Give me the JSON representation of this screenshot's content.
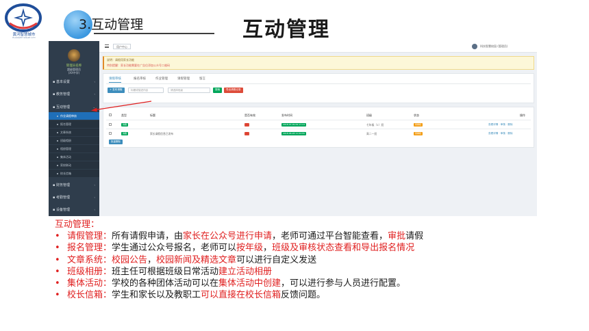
{
  "logo": {
    "name": "黄河智慧城市",
    "subtitle": "HUANGHE SMART CITY"
  },
  "section": {
    "label": "3.互动管理"
  },
  "page_title": "互动管理",
  "screenshot": {
    "sidebar": {
      "user": "管理员名称",
      "role": "超级管理员",
      "school": "(XX中学)",
      "items": [
        {
          "label": "基本设置"
        },
        {
          "label": "教务管理"
        },
        {
          "label": "互动管理"
        },
        {
          "label": "财务管理"
        },
        {
          "label": "考勤管理"
        },
        {
          "label": "设备管理"
        }
      ],
      "subitems": [
        {
          "label": "作业请假审核",
          "active": true
        },
        {
          "label": "报名管理",
          "active": false
        },
        {
          "label": "文章系统",
          "active": false
        },
        {
          "label": "班级相册",
          "active": false
        },
        {
          "label": "相册管理",
          "active": false
        },
        {
          "label": "集体活动",
          "active": false
        },
        {
          "label": "家校联动",
          "active": false
        },
        {
          "label": "校长信箱",
          "active": false
        }
      ]
    },
    "topbar": {
      "tab": "用户中心",
      "user": "科技智慧校园 (管理员)"
    },
    "notice": {
      "line1": "说明：请假用家长功能",
      "line2": "特别提醒：家长功能需要在广告位添加公众号二维码"
    },
    "tabs": [
      "请假审核",
      "报名审核",
      "作业管理",
      "请假管理",
      "留言"
    ],
    "controls": {
      "add": "+ 发布请假",
      "search_placeholder": "标题或描述内容",
      "select": "请选择班级",
      "search": "搜索",
      "export": "导出请假记录"
    },
    "table": {
      "headers": [
        "类型",
        "标题",
        "是否有效",
        "发布时间",
        "班级",
        "状态",
        "操作"
      ],
      "rows": [
        {
          "type": "请假",
          "title": "",
          "valid": "无",
          "time": "2018-07-09 09:17:13",
          "class": "七年级（1）班",
          "status": "待审核",
          "actions": "查看详情 · 审核 · 删除"
        },
        {
          "type": "请假",
          "title": "家长请假信息已发布",
          "valid": "有",
          "time": "2018-06-28 11:04:55",
          "class": "高二一班",
          "status": "待审核",
          "actions": "查看详情 · 审核 · 删除"
        }
      ],
      "bulk_button": "批量删除"
    }
  },
  "description": {
    "heading": "互动管理：",
    "items": [
      {
        "parts": [
          {
            "t": "请假管理：",
            "red": true
          },
          {
            "t": "所有请假申请，由",
            "red": false
          },
          {
            "t": "家长在公众号进行申请",
            "red": true
          },
          {
            "t": "，老师可通过平台智能查看，",
            "red": false
          },
          {
            "t": "审批",
            "red": true
          },
          {
            "t": "请假",
            "red": false
          }
        ]
      },
      {
        "parts": [
          {
            "t": "报名管理：",
            "red": true
          },
          {
            "t": "学生通过公众号报名，老师可以",
            "red": false
          },
          {
            "t": "按年级",
            "red": true
          },
          {
            "t": "，",
            "red": false
          },
          {
            "t": "班级及审核状态查看和导出报名情况",
            "red": true
          }
        ]
      },
      {
        "parts": [
          {
            "t": "文章系统：",
            "red": true
          },
          {
            "t": "校园公告",
            "red": true
          },
          {
            "t": "，",
            "red": false
          },
          {
            "t": "校园新闻及精选文章",
            "red": true
          },
          {
            "t": "可以进行自定义发送",
            "red": false
          }
        ]
      },
      {
        "parts": [
          {
            "t": "班级相册：",
            "red": true
          },
          {
            "t": "班主任可根据班级日常活动",
            "red": false
          },
          {
            "t": "建立活动相册",
            "red": true
          }
        ]
      },
      {
        "parts": [
          {
            "t": "集体活动：",
            "red": true
          },
          {
            "t": "学校的各种团体活动可以在",
            "red": false
          },
          {
            "t": "集体活动中创建",
            "red": true
          },
          {
            "t": "，可以进行参与人员进行配置。",
            "red": false
          }
        ]
      },
      {
        "parts": [
          {
            "t": "校长信箱：",
            "red": true
          },
          {
            "t": "学生和家长以及教职工",
            "red": false
          },
          {
            "t": "可以直接在校长信箱",
            "red": true
          },
          {
            "t": "反馈问题。",
            "red": false
          }
        ]
      }
    ]
  }
}
